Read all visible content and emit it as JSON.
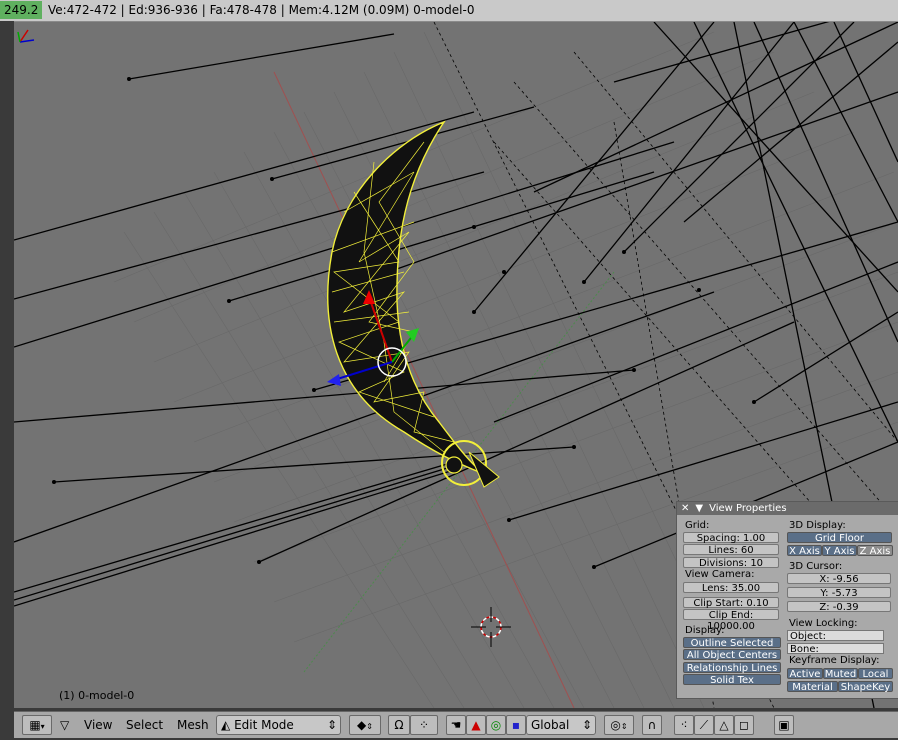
{
  "topbar": {
    "version": "249.2",
    "stats": "Ve:472-472 | Ed:936-936 | Fa:478-478 | Mem:4.12M (0.09M) 0-model-0"
  },
  "viewport": {
    "label": "(1) 0-model-0"
  },
  "view_properties": {
    "title": "View Properties",
    "grid_label": "Grid:",
    "spacing": "Spacing: 1.00",
    "lines": "Lines: 60",
    "divisions": "Divisions: 10",
    "view_camera_label": "View Camera:",
    "lens": "Lens: 35.00",
    "clip_start": "Clip Start: 0.10",
    "clip_end": "Clip End: 10000.00",
    "display_label": "Display:",
    "outline_selected": "Outline Selected",
    "all_object_centers": "All Object Centers",
    "relationship_lines": "Relationship Lines",
    "solid_tex": "Solid Tex",
    "display3d_label": "3D Display:",
    "grid_floor": "Grid Floor",
    "x_axis": "X Axis",
    "y_axis": "Y Axis",
    "z_axis": "Z Axis",
    "cursor_label": "3D Cursor:",
    "cursor_x": "X: -9.56",
    "cursor_y": "Y: -5.73",
    "cursor_z": "Z: -0.39",
    "view_locking_label": "View Locking:",
    "object_label": "Object:",
    "bone_label": "Bone:",
    "keyframe_label": "Keyframe Display:",
    "active": "Active",
    "muted": "Muted",
    "local": "Local",
    "material": "Material",
    "shapekey": "ShapeKey"
  },
  "toolbar": {
    "view": "View",
    "select": "Select",
    "mesh": "Mesh",
    "mode": "Edit Mode",
    "orientation": "Global"
  },
  "colors": {
    "viewport_bg": "#737373",
    "mesh_wire": "#f2ef3a",
    "version_bg": "#5fb05f"
  }
}
